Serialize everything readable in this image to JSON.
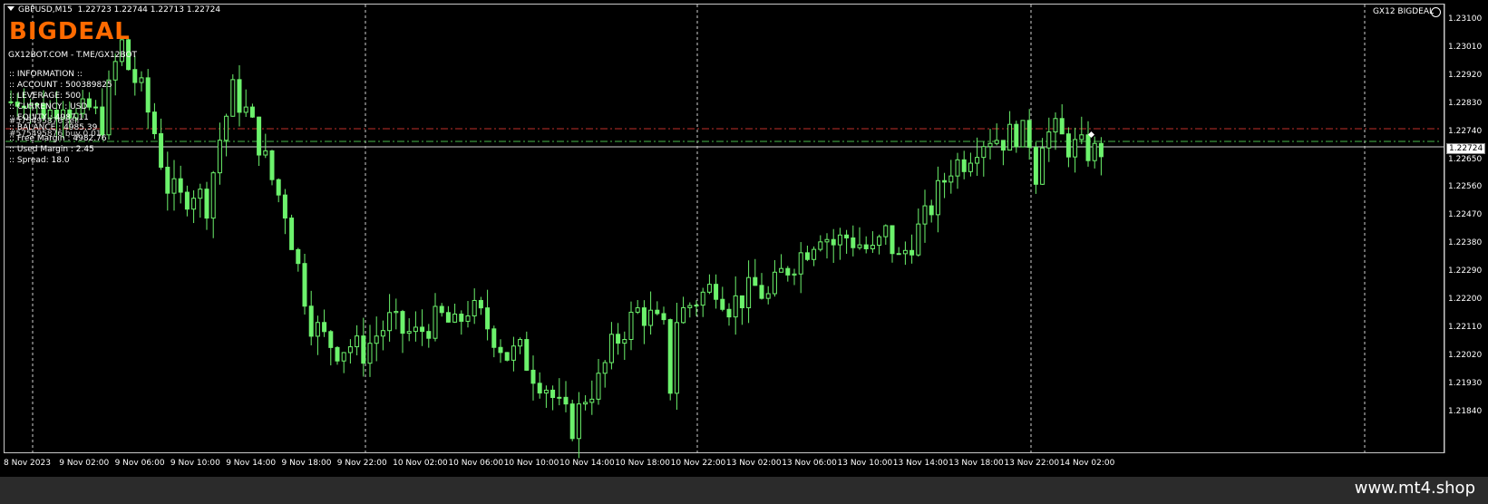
{
  "header": {
    "symbol_line": "GBPUSD,M15  1.22723 1.22744 1.22713 1.22724"
  },
  "overlay": {
    "logo": "BIGDEAL",
    "site": "GX12BOT.COM - T.ME/GX12BOT",
    "ea_label": "GX12 BIGDEAL",
    "info_lines": [
      ":: INFORMATION ::",
      ":: ACCOUNT : 500389825",
      ":: LEVERAGE: 500",
      ":: CURRENCY : USD",
      ":: EQUITY : 4987.11",
      ":: BALANCE : 4985.39",
      ":: Free Margin : 4982.76",
      ":: Used Margin : 2.45",
      ":: Spread: 18.0"
    ],
    "order_labels": [
      "#575495876 sell",
      "#575495876 buy 0.01"
    ]
  },
  "chart_data": {
    "type": "candlestick",
    "symbol": "GBPUSD",
    "timeframe": "M15",
    "current_price": "1.22724",
    "ylim": [
      1.2184,
      1.2315
    ],
    "y_ticks": [
      "1.23100",
      "1.23010",
      "1.22920",
      "1.22830",
      "1.22740",
      "1.22650",
      "1.22560",
      "1.22470",
      "1.22380",
      "1.22290",
      "1.22200",
      "1.22110",
      "1.22020",
      "1.21930",
      "1.21840"
    ],
    "x_ticks": [
      "8 Nov 2023",
      "9 Nov 02:00",
      "9 Nov 06:00",
      "9 Nov 10:00",
      "9 Nov 14:00",
      "9 Nov 18:00",
      "9 Nov 22:00",
      "10 Nov 02:00",
      "10 Nov 06:00",
      "10 Nov 10:00",
      "10 Nov 14:00",
      "10 Nov 18:00",
      "10 Nov 22:00",
      "13 Nov 02:00",
      "13 Nov 06:00",
      "13 Nov 10:00",
      "13 Nov 14:00",
      "13 Nov 18:00",
      "13 Nov 22:00",
      "14 Nov 02:00"
    ],
    "close_path": [
      [
        0,
        1.2287
      ],
      [
        2,
        1.2289
      ],
      [
        4,
        1.2285
      ],
      [
        6,
        1.2284
      ],
      [
        8,
        1.2288
      ],
      [
        10,
        1.2282
      ],
      [
        12,
        1.2285
      ],
      [
        14,
        1.2281
      ],
      [
        15,
        1.229
      ],
      [
        16,
        1.2298
      ],
      [
        17,
        1.2304
      ],
      [
        18,
        1.2297
      ],
      [
        20,
        1.229
      ],
      [
        22,
        1.2278
      ],
      [
        24,
        1.2262
      ],
      [
        26,
        1.2258
      ],
      [
        28,
        1.2261
      ],
      [
        30,
        1.2257
      ],
      [
        32,
        1.2276
      ],
      [
        34,
        1.229
      ],
      [
        36,
        1.2284
      ],
      [
        38,
        1.2275
      ],
      [
        40,
        1.2264
      ],
      [
        42,
        1.2255
      ],
      [
        44,
        1.2238
      ],
      [
        46,
        1.2222
      ],
      [
        48,
        1.2217
      ],
      [
        50,
        1.2214
      ],
      [
        52,
        1.2215
      ],
      [
        54,
        1.2213
      ],
      [
        56,
        1.2218
      ],
      [
        58,
        1.2222
      ],
      [
        60,
        1.2219
      ],
      [
        62,
        1.2218
      ],
      [
        64,
        1.2221
      ],
      [
        66,
        1.2223
      ],
      [
        68,
        1.222
      ],
      [
        70,
        1.2226
      ],
      [
        72,
        1.2223
      ],
      [
        74,
        1.2218
      ],
      [
        76,
        1.2212
      ],
      [
        78,
        1.2213
      ],
      [
        80,
        1.2207
      ],
      [
        82,
        1.2203
      ],
      [
        84,
        1.2196
      ],
      [
        86,
        1.2191
      ],
      [
        88,
        1.22
      ],
      [
        90,
        1.2204
      ],
      [
        92,
        1.2214
      ],
      [
        94,
        1.222
      ],
      [
        96,
        1.2225
      ],
      [
        98,
        1.2223
      ],
      [
        100,
        1.2219
      ],
      [
        101,
        1.2203
      ],
      [
        102,
        1.2223
      ],
      [
        104,
        1.2227
      ],
      [
        106,
        1.223
      ],
      [
        108,
        1.2233
      ],
      [
        110,
        1.2227
      ],
      [
        112,
        1.2229
      ],
      [
        114,
        1.2232
      ],
      [
        116,
        1.2229
      ],
      [
        118,
        1.2236
      ],
      [
        120,
        1.224
      ],
      [
        122,
        1.2244
      ],
      [
        124,
        1.2249
      ],
      [
        126,
        1.2245
      ],
      [
        128,
        1.2247
      ],
      [
        130,
        1.2245
      ],
      [
        132,
        1.2242
      ],
      [
        134,
        1.2248
      ],
      [
        136,
        1.224
      ],
      [
        138,
        1.2246
      ],
      [
        140,
        1.2252
      ],
      [
        142,
        1.226
      ],
      [
        144,
        1.2268
      ],
      [
        146,
        1.227
      ],
      [
        148,
        1.2275
      ],
      [
        150,
        1.2277
      ],
      [
        152,
        1.2276
      ],
      [
        154,
        1.2278
      ],
      [
        156,
        1.2276
      ],
      [
        157,
        1.2266
      ],
      [
        158,
        1.2277
      ],
      [
        160,
        1.2278
      ],
      [
        162,
        1.2274
      ],
      [
        164,
        1.2273
      ],
      [
        166,
        1.2272
      ],
      [
        167,
        1.2273
      ]
    ]
  },
  "watermark": "www.mt4.shop"
}
